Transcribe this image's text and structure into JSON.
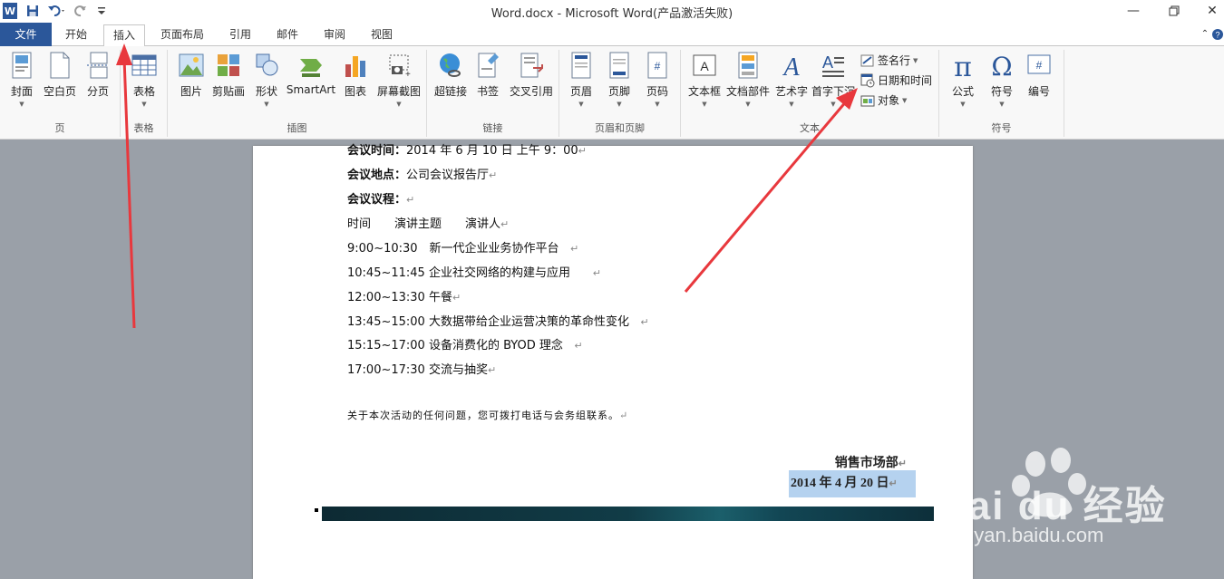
{
  "titlebar": {
    "title": "Word.docx - Microsoft Word(产品激活失败)",
    "word_logo": "W"
  },
  "tabs": [
    {
      "label": "文件"
    },
    {
      "label": "开始"
    },
    {
      "label": "插入"
    },
    {
      "label": "页面布局"
    },
    {
      "label": "引用"
    },
    {
      "label": "邮件"
    },
    {
      "label": "审阅"
    },
    {
      "label": "视图"
    }
  ],
  "ribbon": {
    "groups": {
      "page": "页",
      "table": "表格",
      "illustrations": "插图",
      "links": "链接",
      "header_footer": "页眉和页脚",
      "text": "文本",
      "symbols": "符号"
    },
    "buttons": {
      "cover": "封面",
      "blank_page": "空白页",
      "page_break": "分页",
      "table": "表格",
      "picture": "图片",
      "clip_art": "剪贴画",
      "shapes": "形状",
      "smartart": "SmartArt",
      "chart": "图表",
      "screenshot": "屏幕截图",
      "hyperlink": "超链接",
      "bookmark": "书签",
      "cross_ref": "交叉引用",
      "header": "页眉",
      "footer": "页脚",
      "page_number": "页码",
      "text_box": "文本框",
      "quick_parts": "文档部件",
      "wordart": "艺术字",
      "drop_cap": "首字下沉",
      "signature_line": "签名行",
      "date_time": "日期和时间",
      "object": "对象",
      "equation": "公式",
      "symbol": "符号",
      "number": "编号"
    }
  },
  "document": {
    "meeting_time_label": "会议时间：",
    "meeting_time_value": "2014 年 6 月 10 日 上午 9：00",
    "meeting_place_label": "会议地点：",
    "meeting_place_value": "公司会议报告厅",
    "agenda_label": "会议议程：",
    "agenda_header": "时间　　演讲主题　　演讲人",
    "agenda": [
      "9:00~10:30　新一代企业业务协作平台",
      "10:45~11:45 企业社交网络的构建与应用",
      "12:00~13:30 午餐",
      "13:45~15:00 大数据带给企业运营决策的革命性变化",
      "15:15~17:00 设备消费化的 BYOD 理念",
      "17:00~17:30 交流与抽奖"
    ],
    "contact_note": "关于本次活动的任何问题，您可拨打电话与会务组联系。",
    "department": "销售市场部",
    "date": "2014 年 4 月 20 日",
    "return_mark": "↵"
  },
  "watermark": {
    "brand": "Bai du 经验",
    "url": "jingyan.baidu.com"
  },
  "colors": {
    "accent": "#2b579a",
    "arrow": "#e8383d",
    "selection": "#b5d2ef"
  }
}
